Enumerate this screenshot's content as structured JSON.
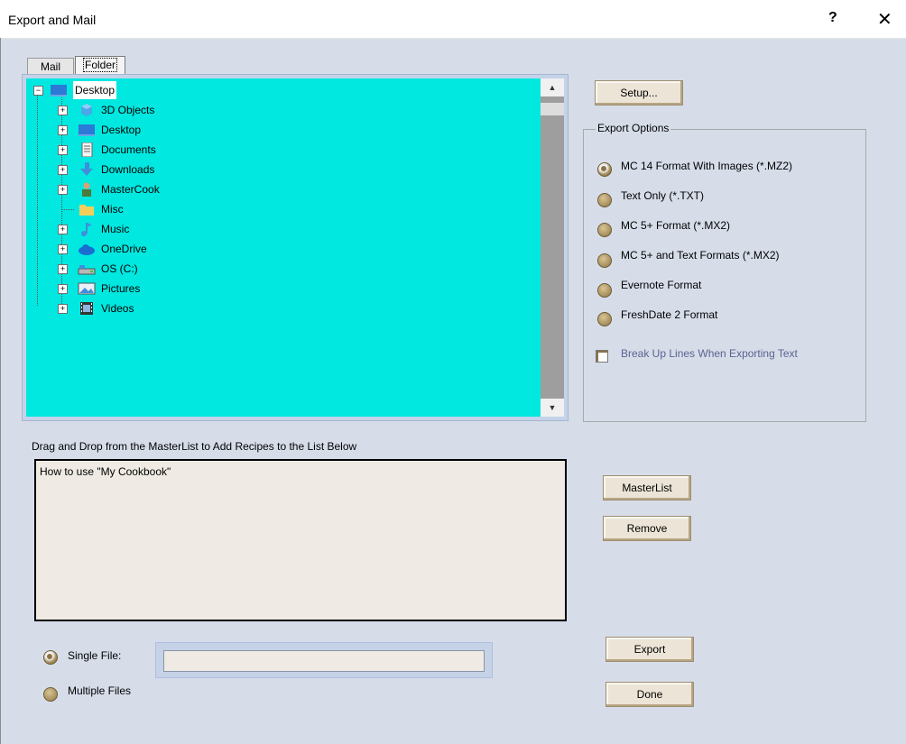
{
  "window": {
    "title": "Export and Mail",
    "help_glyph": "?",
    "close_glyph": "✕"
  },
  "tabs": [
    {
      "label": "Mail"
    },
    {
      "label": "Folder"
    }
  ],
  "tree": {
    "root": {
      "label": "Desktop",
      "expander": "−"
    },
    "items": [
      {
        "label": "3D Objects",
        "icon": "3d-objects-icon",
        "expander": "+"
      },
      {
        "label": "Desktop",
        "icon": "desktop-icon",
        "expander": "+"
      },
      {
        "label": "Documents",
        "icon": "documents-icon",
        "expander": "+"
      },
      {
        "label": "Downloads",
        "icon": "downloads-icon",
        "expander": "+"
      },
      {
        "label": "MasterCook",
        "icon": "user-folder-icon",
        "expander": "+"
      },
      {
        "label": "Misc",
        "icon": "folder-icon",
        "expander": ""
      },
      {
        "label": "Music",
        "icon": "music-icon",
        "expander": "+"
      },
      {
        "label": "OneDrive",
        "icon": "cloud-icon",
        "expander": "+"
      },
      {
        "label": "OS (C:)",
        "icon": "drive-icon",
        "expander": "+"
      },
      {
        "label": "Pictures",
        "icon": "pictures-icon",
        "expander": "+"
      },
      {
        "label": "Videos",
        "icon": "videos-icon",
        "expander": "+"
      }
    ],
    "background_color": "#00e8e0"
  },
  "buttons": {
    "setup": "Setup...",
    "masterlist": "MasterList",
    "remove": "Remove",
    "export": "Export",
    "done": "Done"
  },
  "export_options": {
    "title": "Export Options",
    "options": [
      {
        "label": "MC 14 Format With Images (*.MZ2)",
        "selected": true
      },
      {
        "label": "Text Only (*.TXT)",
        "selected": false
      },
      {
        "label": "MC 5+ Format (*.MX2)",
        "selected": false
      },
      {
        "label": "MC 5+ and Text Formats (*.MX2)",
        "selected": false
      },
      {
        "label": "Evernote Format",
        "selected": false
      },
      {
        "label": "FreshDate 2 Format",
        "selected": false
      }
    ],
    "break_lines_label": "Break Up Lines When Exporting Text",
    "break_lines_checked": true
  },
  "recipes": {
    "instruction": "Drag and Drop from the MasterList to Add Recipes to the  List Below",
    "items": [
      "How to use \"My Cookbook\""
    ]
  },
  "output": {
    "single_file_label": "Single File:",
    "multiple_files_label": "Multiple Files",
    "single_file_selected": true,
    "filename_value": ""
  }
}
